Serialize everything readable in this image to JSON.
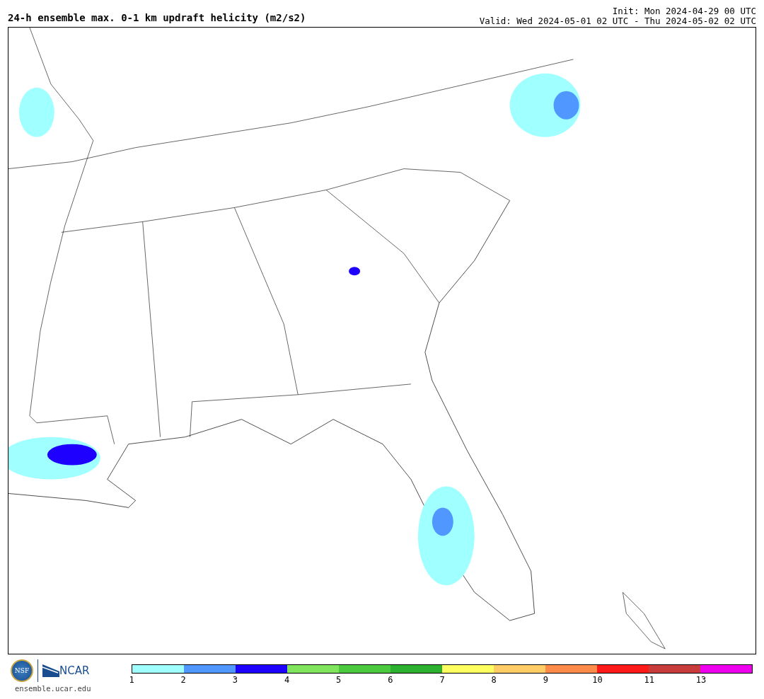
{
  "header": {
    "title": "24-h ensemble max. 0-1 km updraft helicity (m2/s2)",
    "init": "Init: Mon 2024-04-29 00 UTC",
    "valid": "Valid: Wed 2024-05-01 02 UTC - Thu 2024-05-02 02 UTC"
  },
  "footer": {
    "nsf_logo": "NSF",
    "ncar_logo": "NCAR",
    "site": "ensemble.ucar.edu"
  },
  "colorbar": [
    {
      "label": "1",
      "color": "#a0ffff"
    },
    {
      "label": "2",
      "color": "#5098ff"
    },
    {
      "label": "3",
      "color": "#1e00ff"
    },
    {
      "label": "4",
      "color": "#80e55c"
    },
    {
      "label": "5",
      "color": "#4bca40"
    },
    {
      "label": "6",
      "color": "#2bb030"
    },
    {
      "label": "7",
      "color": "#ffff60"
    },
    {
      "label": "8",
      "color": "#ffcc66"
    },
    {
      "label": "9",
      "color": "#ff8b4a"
    },
    {
      "label": "10",
      "color": "#ff1a1a"
    },
    {
      "label": "11",
      "color": "#c83c3c"
    },
    {
      "label": "13",
      "color": "#ee00ee"
    }
  ]
}
